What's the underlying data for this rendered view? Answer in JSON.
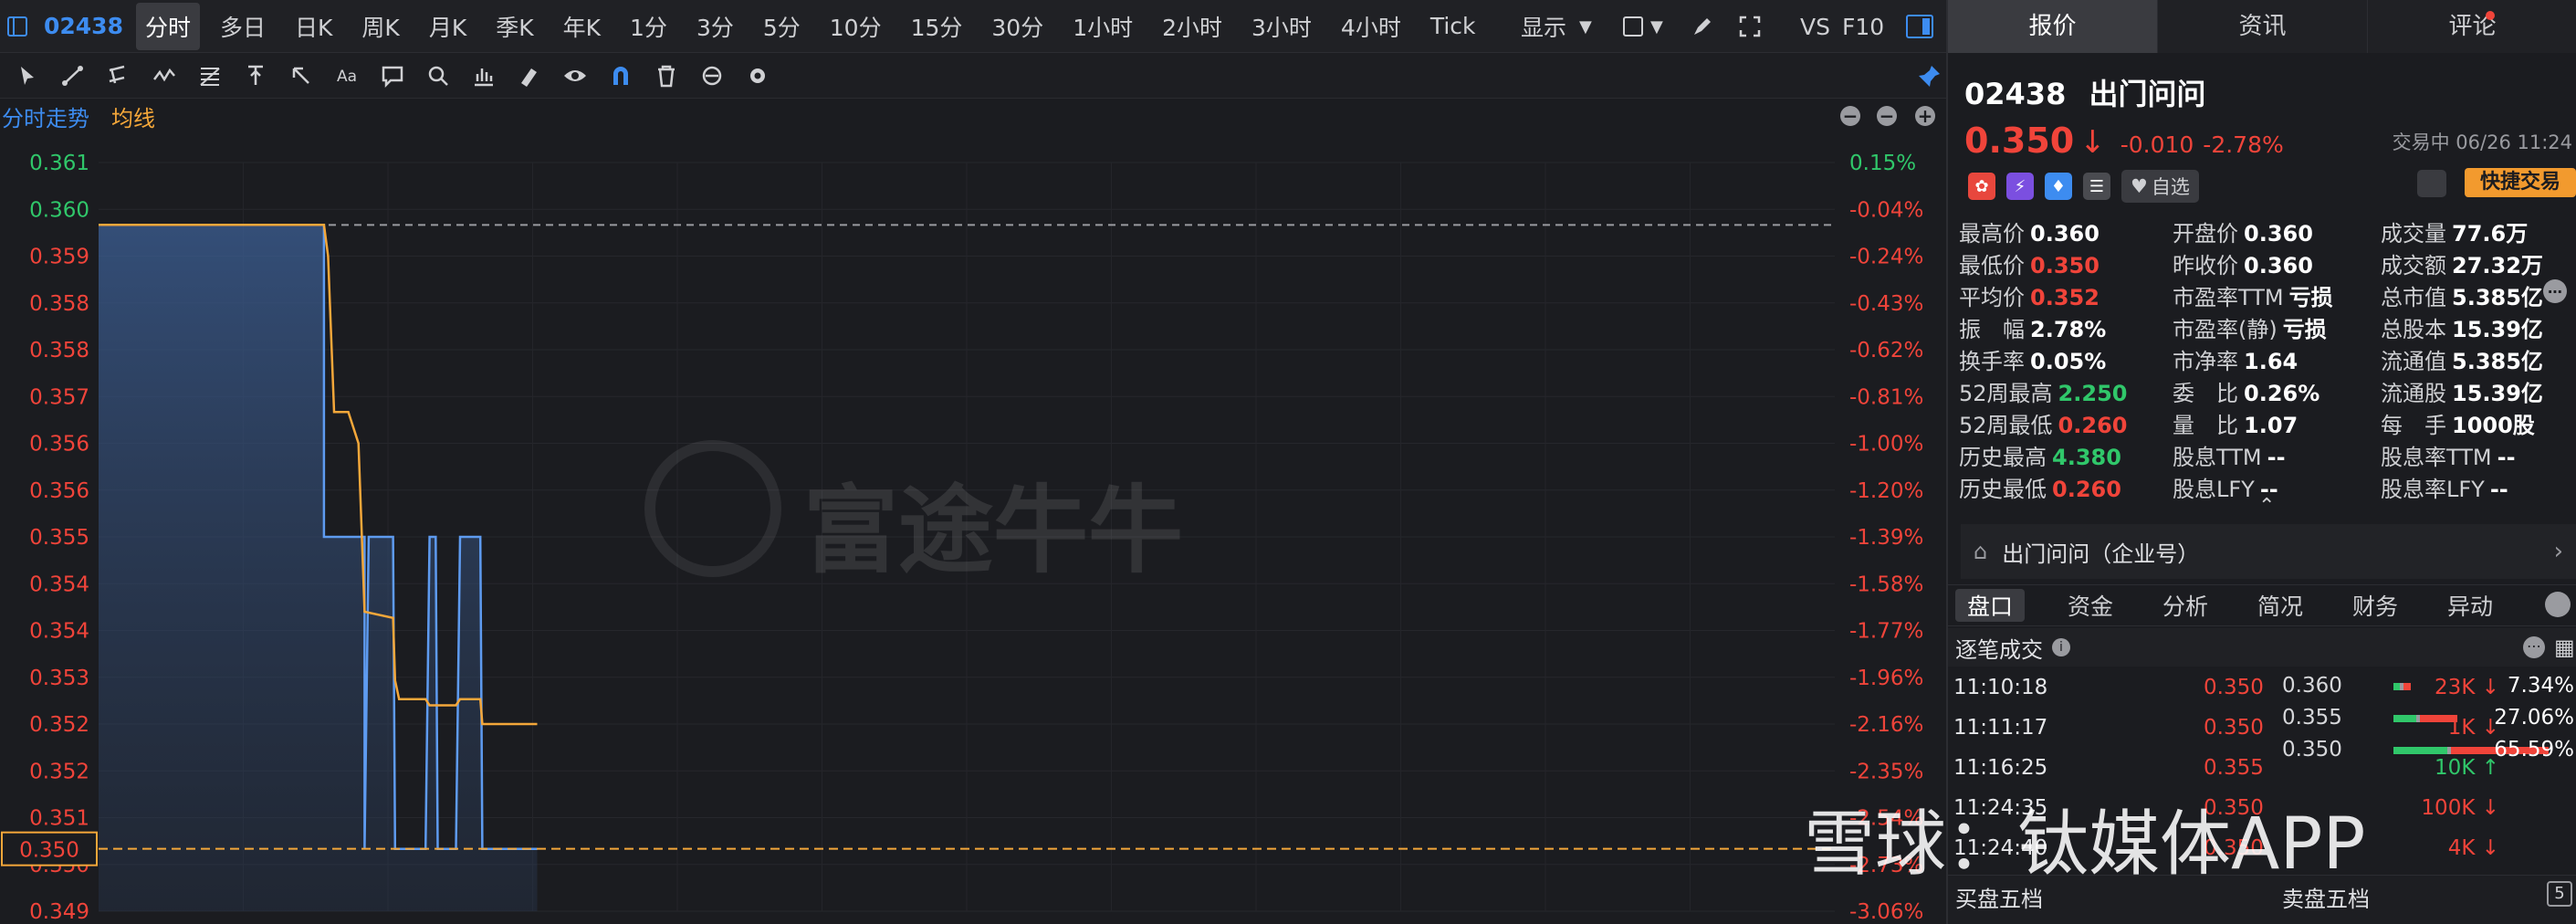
{
  "app": {
    "accent": "#3d8cf0",
    "up_color": "#30c76a",
    "down_color": "#f0443a",
    "avg_color": "#f4a73a"
  },
  "chart_bar": {
    "stock_code": "02438",
    "periods": [
      "分时",
      "多日",
      "日K",
      "周K",
      "月K",
      "季K",
      "年K",
      "1分",
      "3分",
      "5分",
      "10分",
      "15分",
      "30分",
      "1小时",
      "2小时",
      "3小时",
      "4小时",
      "Tick"
    ],
    "active_period": "分时",
    "display_label": "显示",
    "vs_label": "VS",
    "f10_label": "F10"
  },
  "legend": {
    "intraday": "分时走势",
    "average": "均线"
  },
  "watermark": {
    "futu": "富途牛牛",
    "xueqiu": "雪球：钛媒体APP"
  },
  "chart_data": {
    "type": "line",
    "title": "",
    "price_axis": [
      "0.361",
      "0.360",
      "0.359",
      "0.358",
      "0.358",
      "0.357",
      "0.356",
      "0.356",
      "0.355",
      "0.354",
      "0.354",
      "0.353",
      "0.352",
      "0.352",
      "0.351",
      "0.350",
      "0.349"
    ],
    "pct_axis": [
      "0.15%",
      "-0.04%",
      "-0.24%",
      "-0.43%",
      "-0.62%",
      "-0.81%",
      "-1.00%",
      "-1.20%",
      "-1.39%",
      "-1.58%",
      "-1.77%",
      "-1.96%",
      "-2.16%",
      "-2.35%",
      "-2.54%",
      "-2.73%",
      "-3.06%"
    ],
    "ylim": [
      0.349,
      0.361
    ],
    "prev_close": 0.36,
    "current_price_label": "0.350",
    "series": [
      {
        "name": "分时走势",
        "points": [
          [
            0,
            0.36
          ],
          [
            222,
            0.36
          ],
          [
            222,
            0.355
          ],
          [
            262,
            0.355
          ],
          [
            262,
            0.35
          ],
          [
            266,
            0.355
          ],
          [
            290,
            0.355
          ],
          [
            292,
            0.35
          ],
          [
            322,
            0.35
          ],
          [
            326,
            0.355
          ],
          [
            332,
            0.355
          ],
          [
            334,
            0.35
          ],
          [
            352,
            0.35
          ],
          [
            356,
            0.355
          ],
          [
            376,
            0.355
          ],
          [
            378,
            0.35
          ],
          [
            432,
            0.35
          ]
        ]
      },
      {
        "name": "均线",
        "points": [
          [
            0,
            0.36
          ],
          [
            222,
            0.36
          ],
          [
            226,
            0.3595
          ],
          [
            232,
            0.357
          ],
          [
            246,
            0.357
          ],
          [
            256,
            0.3565
          ],
          [
            262,
            0.3538
          ],
          [
            290,
            0.3537
          ],
          [
            292,
            0.3527
          ],
          [
            296,
            0.3524
          ],
          [
            322,
            0.3524
          ],
          [
            326,
            0.3523
          ],
          [
            352,
            0.3523
          ],
          [
            356,
            0.3524
          ],
          [
            376,
            0.3524
          ],
          [
            378,
            0.352
          ],
          [
            432,
            0.352
          ]
        ]
      }
    ]
  },
  "tabs": {
    "quote": "报价",
    "news": "资讯",
    "comments": "评论"
  },
  "stock": {
    "code": "02438",
    "name": "出门问问",
    "price": "0.350",
    "change": "-0.010",
    "change_pct": "-2.78%",
    "trade_time": "交易中 06/26 11:24",
    "watch_label": "自选",
    "quick_trade_label": "快捷交易"
  },
  "stats": {
    "col1": [
      {
        "k": "最高价",
        "v": "0.360",
        "c": ""
      },
      {
        "k": "最低价",
        "v": "0.350",
        "c": "red"
      },
      {
        "k": "平均价",
        "v": "0.352",
        "c": "red"
      },
      {
        "k": "振　幅",
        "v": "2.78%",
        "c": ""
      },
      {
        "k": "换手率",
        "v": "0.05%",
        "c": ""
      },
      {
        "k": "52周最高",
        "v": "2.250",
        "c": "green"
      },
      {
        "k": "52周最低",
        "v": "0.260",
        "c": "red"
      },
      {
        "k": "历史最高",
        "v": "4.380",
        "c": "green"
      },
      {
        "k": "历史最低",
        "v": "0.260",
        "c": "red"
      }
    ],
    "col2": [
      {
        "k": "开盘价",
        "v": "0.360",
        "c": ""
      },
      {
        "k": "昨收价",
        "v": "0.360",
        "c": ""
      },
      {
        "k": "市盈率TTM",
        "v": "亏损",
        "c": ""
      },
      {
        "k": "市盈率(静)",
        "v": "亏损",
        "c": ""
      },
      {
        "k": "市净率",
        "v": "1.64",
        "c": ""
      },
      {
        "k": "委　比",
        "v": "0.26%",
        "c": ""
      },
      {
        "k": "量　比",
        "v": "1.07",
        "c": ""
      },
      {
        "k": "股息TTM",
        "v": "--",
        "c": ""
      },
      {
        "k": "股息LFY",
        "v": "--",
        "c": ""
      }
    ],
    "col3": [
      {
        "k": "成交量",
        "v": "77.6万",
        "c": ""
      },
      {
        "k": "成交额",
        "v": "27.32万",
        "c": ""
      },
      {
        "k": "总市值",
        "v": "5.385亿",
        "c": ""
      },
      {
        "k": "总股本",
        "v": "15.39亿",
        "c": ""
      },
      {
        "k": "流通值",
        "v": "5.385亿",
        "c": ""
      },
      {
        "k": "流通股",
        "v": "15.39亿",
        "c": ""
      },
      {
        "k": "每　手",
        "v": "1000股",
        "c": ""
      },
      {
        "k": "股息率TTM",
        "v": "--",
        "c": ""
      },
      {
        "k": "股息率LFY",
        "v": "--",
        "c": ""
      }
    ]
  },
  "enterprise": {
    "label": "出门问问（企业号）"
  },
  "sub_tabs": [
    "盘口",
    "资金",
    "分析",
    "简况",
    "财务",
    "异动"
  ],
  "trades": {
    "title": "逐笔成交",
    "rows": [
      {
        "time": "11:10:18",
        "price": "0.350",
        "qty": "23K",
        "dir": "down"
      },
      {
        "time": "11:11:17",
        "price": "0.350",
        "qty": "1K",
        "dir": "down"
      },
      {
        "time": "11:16:25",
        "price": "0.355",
        "qty": "10K",
        "dir": "up"
      },
      {
        "time": "11:24:35",
        "price": "0.350",
        "qty": "100K",
        "dir": "down"
      },
      {
        "time": "11:24:40",
        "price": "0.350",
        "qty": "4K",
        "dir": "down"
      }
    ],
    "distribution": [
      {
        "price": "0.360",
        "pct": "7.34%",
        "frac": 0.0734
      },
      {
        "price": "0.355",
        "pct": "27.06%",
        "frac": 0.2706
      },
      {
        "price": "0.350",
        "pct": "65.59%",
        "frac": 0.6559
      }
    ]
  },
  "order_book": {
    "bid_label": "买盘五档",
    "ask_label": "卖盘五档",
    "depth": "5"
  }
}
